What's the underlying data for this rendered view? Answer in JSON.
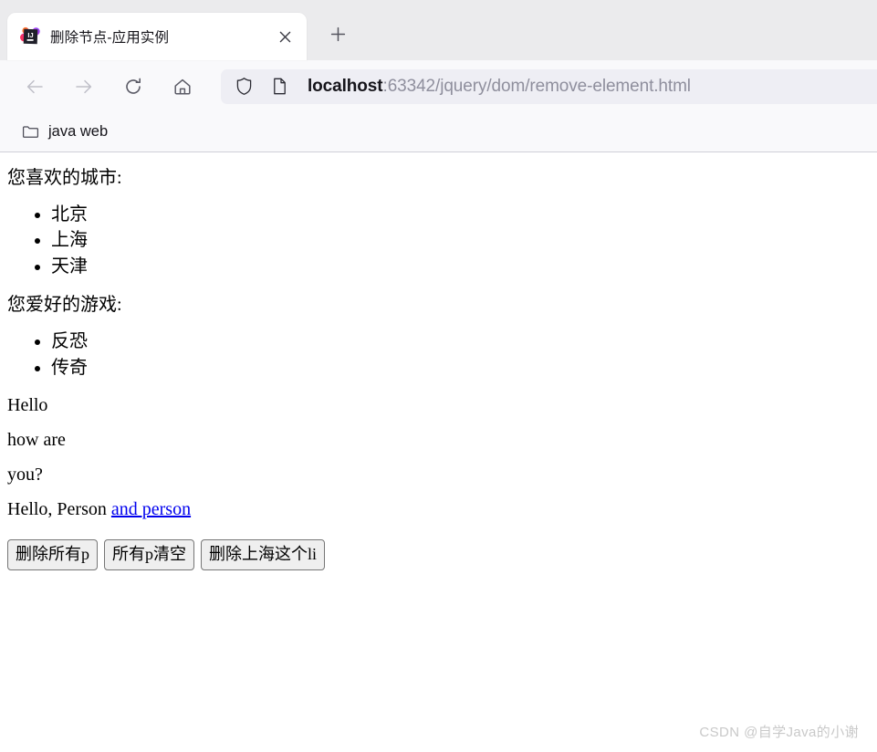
{
  "browser": {
    "tab": {
      "title": "删除节点-应用实例",
      "favicon_name": "intellij-idea-favicon",
      "close_label": "×"
    },
    "newtab_label": "+",
    "nav": {
      "back_label": "←",
      "forward_label": "→",
      "reload_label": "⟳",
      "home_label": "⌂"
    },
    "urlbar": {
      "shield_icon": "shield-icon",
      "page_icon": "page-icon",
      "host": "localhost",
      "path": ":63342/jquery/dom/remove-element.html",
      "full_url": "localhost:63342/jquery/dom/remove-element.html"
    },
    "bookmarks": [
      {
        "label": "java web",
        "icon": "folder-icon"
      }
    ]
  },
  "page": {
    "cities_heading": "您喜欢的城市:",
    "cities": [
      "北京",
      "上海",
      "天津"
    ],
    "games_heading": "您爱好的游戏:",
    "games": [
      "反恐",
      "传奇"
    ],
    "paragraphs": [
      "Hello",
      "how are",
      "you?"
    ],
    "person_text": "Hello, Person ",
    "person_link": "and person",
    "buttons": [
      "删除所有p",
      "所有p清空",
      "删除上海这个li"
    ],
    "link_color": "#0000ee"
  },
  "watermark": "CSDN @自学Java的小谢"
}
